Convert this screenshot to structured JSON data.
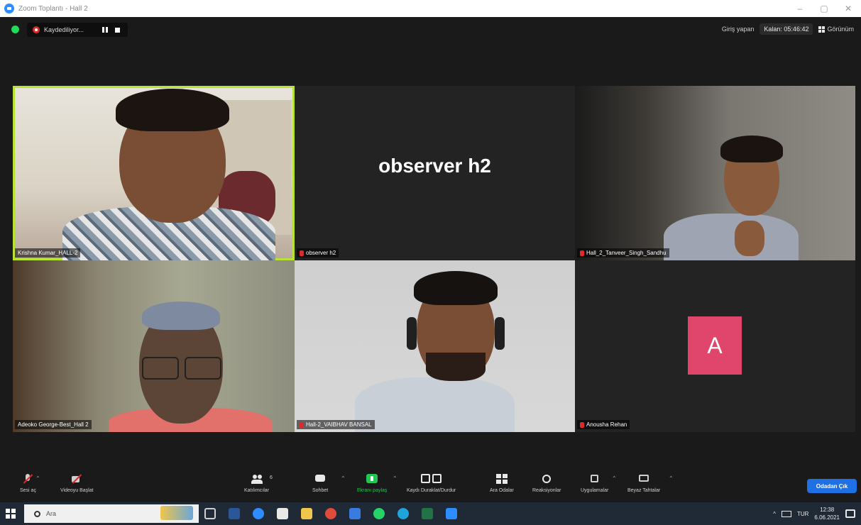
{
  "window": {
    "title": "Zoom Toplantı - Hall 2",
    "minimize": "–",
    "maximize": "▢",
    "close": "✕"
  },
  "topbar": {
    "recording_label": "Kaydediliyor...",
    "right_label": "Giriş yapan",
    "timer": "Kalan: 05:46:42",
    "view_label": "Görünüm"
  },
  "tiles": [
    {
      "name": "Krishna Kumar_HALL-2",
      "muted": false,
      "active": true
    },
    {
      "name": "observer h2",
      "display_name": "observer h2",
      "muted": true
    },
    {
      "name": "Hall_2_Tanveer_Singh_Sandhu",
      "muted": true
    },
    {
      "name": "Adeoko George-Best_Hall 2",
      "muted": false
    },
    {
      "name": "Hall-2_VAIBHAV BANSAL",
      "muted": true
    },
    {
      "name": "Anousha Rehan",
      "muted": true,
      "avatar_letter": "A",
      "avatar_color": "#e0466b"
    }
  ],
  "toolbar": {
    "mute": "Sesi aç",
    "video": "Videoyu Başlat",
    "participants": "Katılımcılar",
    "participants_count": "6",
    "chat": "Sohbet",
    "share": "Ekranı paylaş",
    "record": "Kaydı Duraklat/Durdur",
    "breakout": "Ara Odalar",
    "reactions": "Reaksiyonlar",
    "apps": "Uygulamalar",
    "whiteboard": "Beyaz Tahtalar",
    "end": "Odadan Çık",
    "accent": "#1f6fe5",
    "share_color": "#23c553"
  },
  "taskbar": {
    "search_placeholder": "Ara",
    "lang": "TUR",
    "time": "12:38",
    "date": "6.06.2021"
  }
}
